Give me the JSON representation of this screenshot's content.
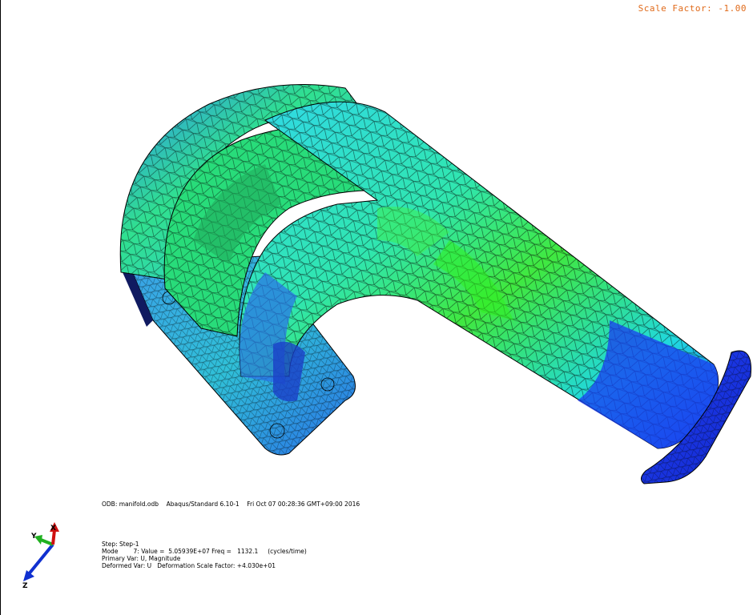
{
  "viewport": {
    "scale_factor": "Scale Factor: -1.00"
  },
  "model": {
    "name": "manifold mesh (deformed, mode shape contour)"
  },
  "info_block": {
    "odb_line": "ODB: manifold.odb    Abaqus/Standard 6.10-1    Fri Oct 07 00:28:36 GMT+09:00 2016",
    "step_line": "Step: Step-1",
    "mode_line": "Mode        7: Value =  5.05939E+07 Freq =   1132.1     (cycles/time)",
    "primary_line": "Primary Var: U, Magnitude",
    "deformed_line": "Deformed Var: U   Deformation Scale Factor: +4.030e+01"
  },
  "triad": {
    "x_label": "X",
    "y_label": "Y",
    "z_label": "Z",
    "x_color": "#d01010",
    "y_color": "#20b020",
    "z_color": "#1030d0"
  },
  "colors": {
    "blue": "#1a3cf0",
    "light_blue": "#2f8ff0",
    "cyan": "#20e0e0",
    "green": "#20e060",
    "light_green": "#40f040",
    "scale_text": "#e06a1a"
  }
}
